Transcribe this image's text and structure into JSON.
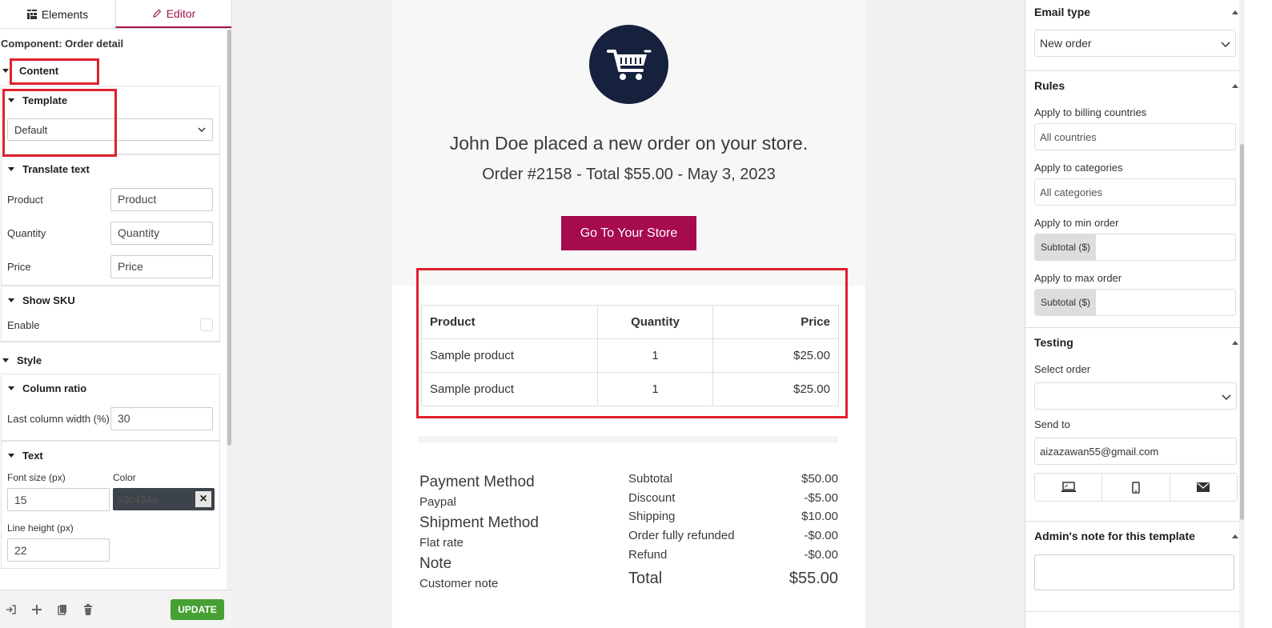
{
  "left_panel": {
    "tabs": [
      {
        "label": "Elements",
        "icon": "grid-icon"
      },
      {
        "label": "Editor",
        "icon": "pencil-icon"
      }
    ],
    "component_title": "Component: Order detail",
    "content_label": "Content",
    "template": {
      "heading": "Template",
      "selected": "Default"
    },
    "translate_text": {
      "heading": "Translate text",
      "fields": [
        {
          "label": "Product",
          "value": "Product"
        },
        {
          "label": "Quantity",
          "value": "Quantity"
        },
        {
          "label": "Price",
          "value": "Price"
        }
      ]
    },
    "show_sku": {
      "heading": "Show SKU",
      "enable_label": "Enable",
      "checked": false
    },
    "style_label": "Style",
    "column_ratio": {
      "heading": "Column ratio",
      "label": "Last column width (%)",
      "value": "30"
    },
    "text_section": {
      "heading": "Text",
      "font_size_label": "Font size (px)",
      "font_size_value": "15",
      "color_label": "Color",
      "color_value": "#3c434a",
      "line_height_label": "Line height (px)",
      "line_height_value": "22"
    },
    "footer": {
      "update_label": "UPDATE"
    }
  },
  "email": {
    "heading": "John Doe placed a new order on your store.",
    "subheading": "Order #2158 - Total $55.00 - May 3, 2023",
    "button_label": "Go To Your Store",
    "table": {
      "headers": [
        "Product",
        "Quantity",
        "Price"
      ],
      "rows": [
        [
          "Sample product",
          "1",
          "$25.00"
        ],
        [
          "Sample product",
          "1",
          "$25.00"
        ]
      ]
    },
    "payment_method_label": "Payment Method",
    "payment_method_value": "Paypal",
    "shipment_method_label": "Shipment Method",
    "shipment_method_value": "Flat rate",
    "note_label": "Note",
    "note_value": "Customer note",
    "totals": [
      {
        "label": "Subtotal",
        "value": "$50.00"
      },
      {
        "label": "Discount",
        "value": "-$5.00"
      },
      {
        "label": "Shipping",
        "value": "$10.00"
      },
      {
        "label": "Order fully refunded",
        "value": "-$0.00"
      },
      {
        "label": "Refund",
        "value": "-$0.00"
      }
    ],
    "total": {
      "label": "Total",
      "value": "$55.00"
    }
  },
  "right_panel": {
    "email_type": {
      "heading": "Email type",
      "selected": "New order"
    },
    "rules": {
      "heading": "Rules",
      "billing_label": "Apply to billing countries",
      "billing_placeholder": "All countries",
      "categories_label": "Apply to categories",
      "categories_placeholder": "All categories",
      "min_label": "Apply to min order",
      "min_prefix": "Subtotal ($)",
      "max_label": "Apply to max order",
      "max_prefix": "Subtotal ($)"
    },
    "testing": {
      "heading": "Testing",
      "select_label": "Select order",
      "send_label": "Send to",
      "send_value": "aizazawan55@gmail.com"
    },
    "admin_note": {
      "heading": "Admin's note for this template"
    }
  },
  "colors": {
    "accent": "#a0124e",
    "button": "#a60a4f",
    "navy": "#16213e",
    "update": "#46a033",
    "highlight": "#e0202e"
  }
}
